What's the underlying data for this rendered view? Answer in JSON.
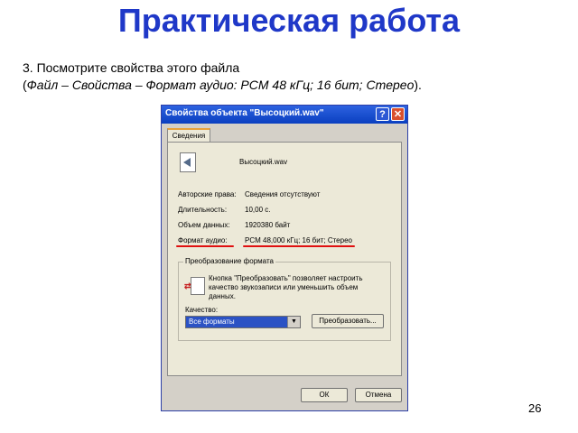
{
  "slide": {
    "title": "Практическая работа",
    "line1": "3. Посмотрите свойства этого файла",
    "line2_open": "(",
    "line2_italic": "Файл – Свойства – Формат аудио: PCM 48 кГц; 16 бит; Стерео",
    "line2_close": ").",
    "page_number": "26"
  },
  "dialog": {
    "title": "Свойства объекта \"Высоцкий.wav\"",
    "help_glyph": "?",
    "close_glyph": "✕",
    "tab": "Сведения",
    "file_name": "Высоцкий.wav",
    "properties": [
      {
        "label": "Авторские права:",
        "value": "Сведения отсутствуют"
      },
      {
        "label": "Длительность:",
        "value": "10,00 с."
      },
      {
        "label": "Объем данных:",
        "value": "1920380 байт"
      },
      {
        "label": "Формат аудио:",
        "value": "PCM 48,000 кГц; 16 бит; Стерео"
      }
    ],
    "conversion": {
      "group_title": "Преобразование формата",
      "description": "Кнопка \"Преобразовать\" позволяет настроить качество звукозаписи или уменьшить объем данных.",
      "quality_label": "Качество:",
      "quality_value": "Все форматы",
      "convert_button": "Преобразовать..."
    },
    "ok_button": "ОК",
    "cancel_button": "Отмена"
  },
  "colors": {
    "title": "#1f38c8",
    "titlebar": "#0a3fc0",
    "underline": "#e01010"
  }
}
